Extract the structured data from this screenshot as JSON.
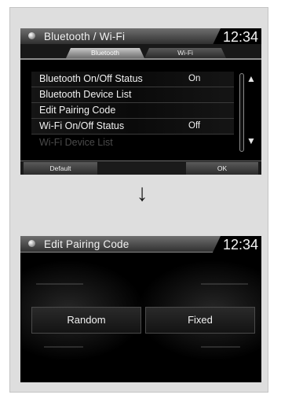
{
  "screen1": {
    "title": "Bluetooth / Wi-Fi",
    "time": "12:34",
    "tabs": [
      {
        "label": "Bluetooth",
        "active": true
      },
      {
        "label": "Wi-Fi",
        "active": false
      }
    ],
    "items": [
      {
        "label": "Bluetooth On/Off Status",
        "value": "On"
      },
      {
        "label": "Bluetooth Device List",
        "value": ""
      },
      {
        "label": "Edit Pairing Code",
        "value": ""
      },
      {
        "label": "Wi-Fi On/Off Status",
        "value": "Off"
      },
      {
        "label": "Wi-Fi Device List",
        "value": "",
        "disabled": true
      }
    ],
    "buttons": {
      "default": "Default",
      "ok": "OK"
    },
    "icons": {
      "title": "settings-dot-icon",
      "scroll_up": "double-chevron-up-icon",
      "scroll_down": "double-chevron-down-icon"
    }
  },
  "arrow_icon": "down-arrow-icon",
  "screen2": {
    "title": "Edit Pairing Code",
    "time": "12:34",
    "buttons": {
      "random": "Random",
      "fixed": "Fixed"
    }
  }
}
